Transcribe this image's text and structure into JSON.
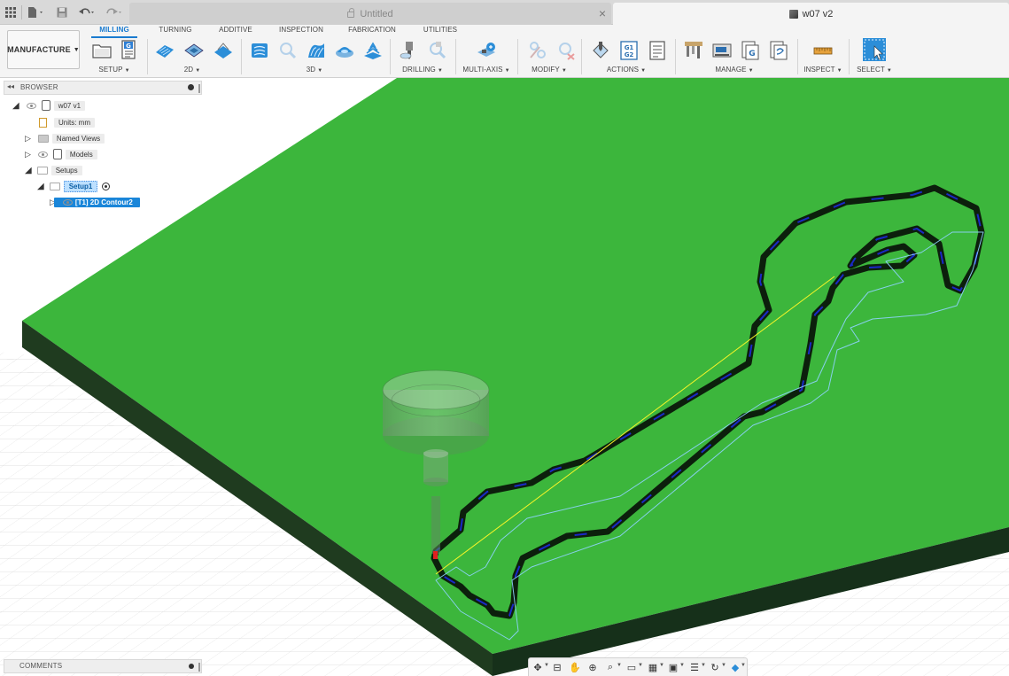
{
  "titlebar": {
    "tabs": [
      {
        "title": "Untitled",
        "active": false
      },
      {
        "title": "w07 v2",
        "active": true
      }
    ]
  },
  "toolbar": {
    "workspace": "MANUFACTURE",
    "workspace_tabs": [
      "MILLING",
      "TURNING",
      "ADDITIVE",
      "INSPECTION",
      "FABRICATION",
      "UTILITIES"
    ],
    "active_tab": "MILLING",
    "groups": [
      "SETUP",
      "2D",
      "3D",
      "DRILLING",
      "MULTI-AXIS",
      "MODIFY",
      "ACTIONS",
      "MANAGE",
      "INSPECT",
      "SELECT"
    ],
    "icons": {
      "setup": [
        "new-setup-icon",
        "nc-program-icon"
      ],
      "2d": [
        "2d-adaptive-icon",
        "2d-pocket-icon",
        "face-icon"
      ],
      "3d": [
        "3d-adaptive-icon",
        "3d-steep-shallow-icon",
        "flow-icon",
        "3d-radial-icon",
        "3d-contour-icon"
      ],
      "drilling": [
        "drill-icon",
        "hole-recognition-icon"
      ],
      "multi_axis": [
        "multi-axis-icon"
      ],
      "modify": [
        "modify-paths-icon",
        "delete-paths-icon"
      ],
      "actions": [
        "simulate-icon",
        "post-process-icon",
        "setup-sheet-icon"
      ],
      "manage": [
        "tool-library-icon",
        "machine-library-icon",
        "post-library-icon",
        "templates-icon"
      ],
      "inspect": [
        "measure-icon"
      ],
      "select": [
        "select-icon"
      ]
    }
  },
  "browser": {
    "title": "BROWSER",
    "nodes": {
      "root": "w07 v1",
      "units": "Units: mm",
      "named_views": "Named Views",
      "models": "Models",
      "setups": "Setups",
      "setup1": "Setup1",
      "operation": "[T1] 2D Contour2"
    }
  },
  "comments": {
    "title": "COMMENTS"
  },
  "navbar": {
    "icons": [
      "orbit-icon",
      "look-at-icon",
      "pan-icon",
      "zoom-window-icon",
      "zoom-icon",
      "display-settings-icon",
      "grid-icon",
      "viewports-icon",
      "environment-icon",
      "refresh-icon",
      "effects-icon"
    ]
  },
  "colors": {
    "stock_top": "#3cb63c",
    "stock_side": "#1c3a1c",
    "accent": "#1a7bd0",
    "selection": "#1a86d9",
    "toolpath": "#8fd3ff",
    "rapid": "#f5f528"
  }
}
